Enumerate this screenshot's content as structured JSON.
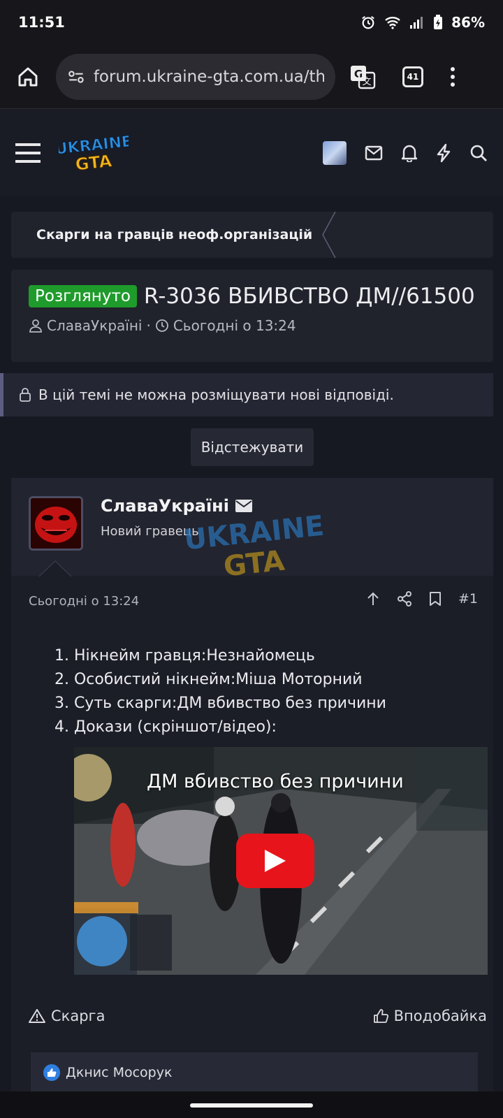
{
  "status": {
    "time": "11:51",
    "battery": "86%"
  },
  "browser": {
    "url": "forum.ukraine-gta.com.ua/th",
    "tab_count": "41"
  },
  "site": {
    "logo_top": "UKRAINE",
    "logo_bottom": "GTA"
  },
  "breadcrumb": {
    "label": "Скарги на гравців неоф.організацій"
  },
  "thread": {
    "badge": "Розглянуто",
    "title": "R-3036 ВБИВСТВО ДМ//61500",
    "author": "СлаваУкраїні",
    "separator": "·",
    "date": "Сьогодні о 13:24"
  },
  "notice": {
    "text": "В цій темі не можна розміщувати нові відповіді."
  },
  "watch_button": "Відстежувати",
  "post": {
    "username": "СлаваУкраїні",
    "role": "Новий гравець",
    "date": "Сьогодні о 13:24",
    "number": "#1",
    "items": [
      "1. Нікнейм гравця:Незнайомець",
      "2. Особистий нікнейм:Міша Моторний",
      "3. Суть скарги:ДМ вбивство без причини",
      "4. Докази (скріншот/відео):"
    ],
    "video_title": "ДМ вбивство без причини",
    "report_label": "Скарга",
    "like_label": "Вподобайка",
    "liked_by": "Дкнис Мосорук"
  },
  "colors": {
    "badge_green": "#1f9b2c",
    "youtube_red": "#e8141b",
    "logo_blue": "#2a8fe0",
    "logo_yellow": "#f2b51e"
  }
}
